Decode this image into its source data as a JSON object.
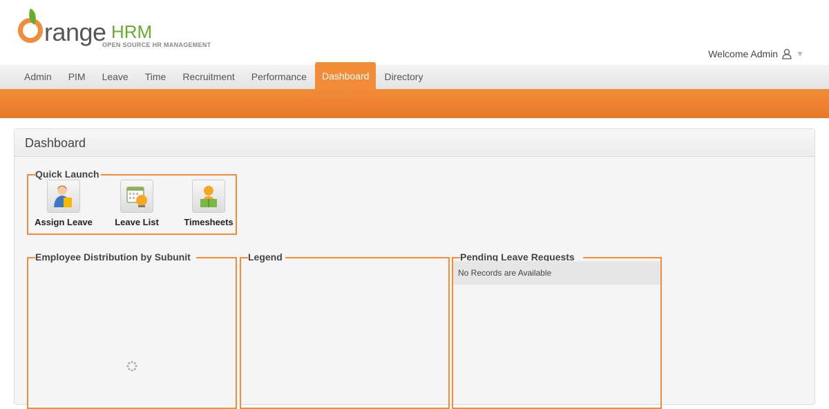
{
  "brand": {
    "word": "range",
    "hrm": "HRM",
    "tagline": "OPEN SOURCE HR MANAGEMENT",
    "color_orange": "#f28c38",
    "color_green": "#6aab2e"
  },
  "header": {
    "welcome": "Welcome Admin"
  },
  "menu": {
    "items": [
      {
        "label": "Admin"
      },
      {
        "label": "PIM"
      },
      {
        "label": "Leave"
      },
      {
        "label": "Time"
      },
      {
        "label": "Recruitment"
      },
      {
        "label": "Performance"
      },
      {
        "label": "Dashboard",
        "active": true
      },
      {
        "label": "Directory"
      }
    ]
  },
  "page": {
    "title": "Dashboard"
  },
  "quick_launch": {
    "title": "Quick Launch",
    "items": [
      {
        "label": "Assign Leave",
        "icon": "assign-leave-icon"
      },
      {
        "label": "Leave List",
        "icon": "leave-list-icon"
      },
      {
        "label": "Timesheets",
        "icon": "timesheets-icon"
      }
    ]
  },
  "panels": {
    "employee_distribution": {
      "title": "Employee Distribution by Subunit"
    },
    "legend": {
      "title": "Legend"
    },
    "pending": {
      "title": "Pending Leave Requests",
      "empty": "No Records are Available"
    }
  }
}
